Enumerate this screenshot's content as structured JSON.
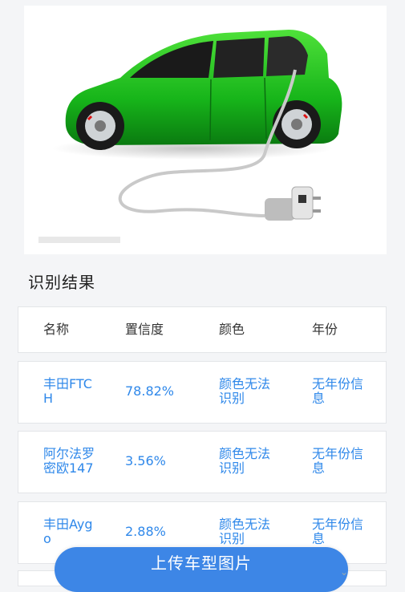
{
  "image": {
    "icon": "electric-car-with-charging-plug"
  },
  "results": {
    "title": "识别结果",
    "headers": {
      "name": "名称",
      "confidence": "置信度",
      "color": "颜色",
      "year": "年份"
    },
    "rows": [
      {
        "name": "丰田FTCH",
        "confidence": "78.82%",
        "color": "颜色无法识别",
        "year": "无年份信息"
      },
      {
        "name": "阿尔法罗密欧147",
        "confidence": "3.56%",
        "color": "颜色无法识别",
        "year": "无年份信息"
      },
      {
        "name": "丰田Aygo",
        "confidence": "2.88%",
        "color": "颜色无法识别",
        "year": "无年份信息"
      }
    ]
  },
  "upload_button": {
    "label": "上传车型图片"
  },
  "colors": {
    "accent": "#3d86e6",
    "result_text": "#2f88ea"
  }
}
